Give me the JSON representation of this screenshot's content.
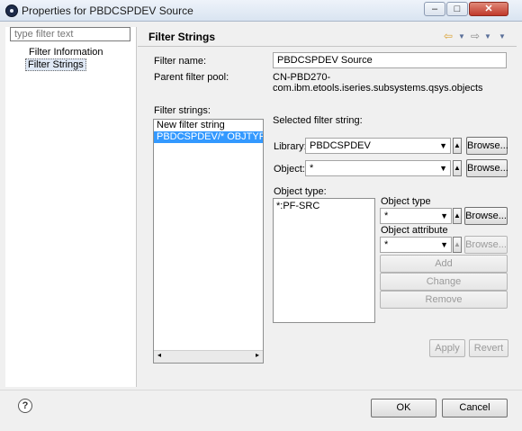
{
  "window": {
    "title": "Properties for PBDCSPDEV Source",
    "minimize": "–",
    "maximize": "□",
    "close": "✕"
  },
  "nav": {
    "filter_placeholder": "type filter text",
    "items": [
      {
        "label": "Filter Information"
      },
      {
        "label": "Filter Strings"
      }
    ]
  },
  "page": {
    "title": "Filter Strings",
    "filter_name_label": "Filter name:",
    "filter_name_value": "PBDCSPDEV Source",
    "parent_pool_label": "Parent filter pool:",
    "parent_pool_value": "CN-PBD270-com.ibm.etools.iseries.subsystems.qsys.objects",
    "filter_strings_label": "Filter strings:",
    "filter_strings": [
      {
        "text": "New filter string",
        "selected": false
      },
      {
        "text": "PBDCSPDEV/* OBJTYPE(*:PF",
        "selected": true
      }
    ],
    "selected_label": "Selected filter string:",
    "library_label": "Library:",
    "library_value": "PBDCSPDEV",
    "object_label": "Object:",
    "object_value": "*",
    "browse": "Browse...",
    "object_type_list_label": "Object type:",
    "object_type_items": [
      "*:PF-SRC"
    ],
    "object_type_label": "Object type",
    "object_type_value": "*",
    "object_attribute_label": "Object attribute",
    "object_attribute_value": "*",
    "add": "Add",
    "change": "Change",
    "remove": "Remove",
    "apply": "Apply",
    "revert": "Revert"
  },
  "footer": {
    "help": "?",
    "ok": "OK",
    "cancel": "Cancel"
  }
}
